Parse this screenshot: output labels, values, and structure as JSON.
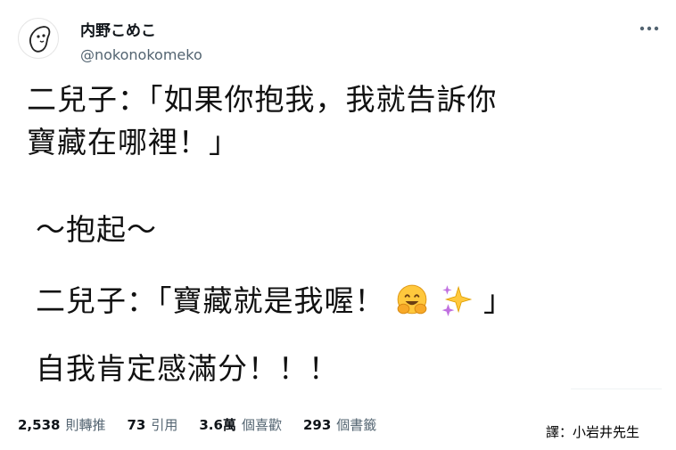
{
  "user": {
    "display_name": "内野こめこ",
    "handle": "@nokonokomeko"
  },
  "tweet": {
    "line1": "二兒子：「如果你抱我，我就告訴你",
    "line2": "寶藏在哪裡！」",
    "line3": "～抱起～",
    "line4_before": "二兒子：「寶藏就是我喔！",
    "line4_after": "」",
    "line5": "自我肯定感滿分！！！",
    "emojis": [
      "hugging-face-icon",
      "sparkles-icon"
    ]
  },
  "stats": {
    "retweets_count": "2,538",
    "retweets_label": "則轉推",
    "quotes_count": "73",
    "quotes_label": "引用",
    "likes_count": "3.6萬",
    "likes_label": "個喜歡",
    "bookmarks_count": "293",
    "bookmarks_label": "個書籤"
  },
  "translator": "譯：小岩井先生",
  "colors": {
    "text": "#0f1419",
    "secondary": "#536471",
    "emoji_face": "#f7b731",
    "sparkle_yellow": "#ffc83d",
    "sparkle_purple": "#c070e0"
  }
}
